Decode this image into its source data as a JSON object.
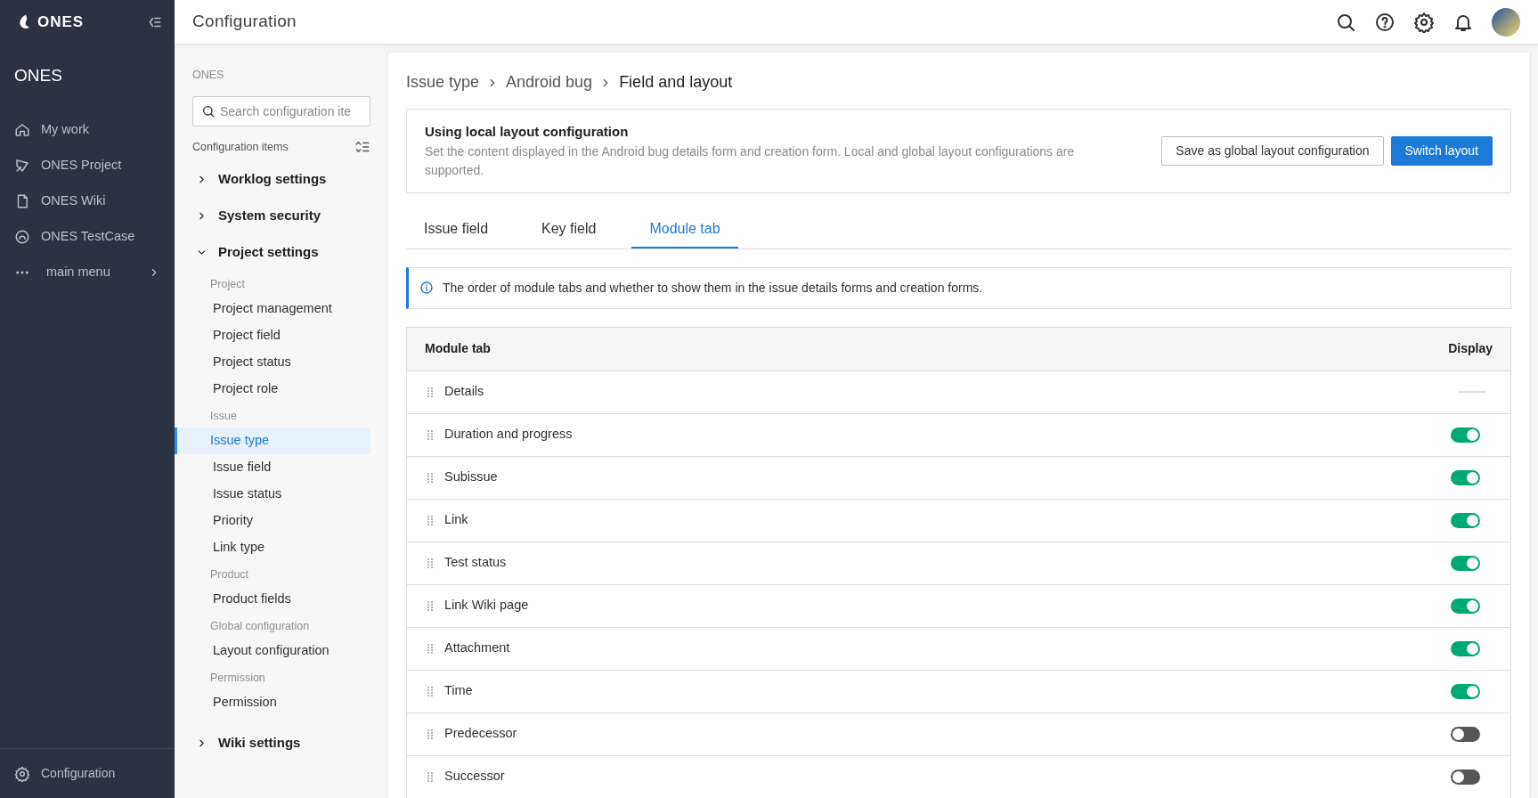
{
  "app_sidebar": {
    "logo_text": "ONES",
    "workspace": "ONES",
    "items": [
      {
        "label": "My work",
        "kind": "app"
      },
      {
        "label": "ONES Project",
        "kind": "app"
      },
      {
        "label": "ONES Wiki",
        "kind": "app"
      },
      {
        "label": "ONES TestCase",
        "kind": "app"
      },
      {
        "label": "main menu",
        "kind": "menu"
      }
    ],
    "footer": "Configuration"
  },
  "header": {
    "title": "Configuration"
  },
  "config_nav": {
    "org": "ONES",
    "search": {
      "placeholder": "Search configuration ite"
    },
    "heading": "Configuration items",
    "sections": [
      {
        "label": "Worklog settings",
        "expanded": false
      },
      {
        "label": "System security",
        "expanded": false
      },
      {
        "label": "Project settings",
        "expanded": true,
        "groups": [
          {
            "label": "Project",
            "items": [
              {
                "label": "Project management",
                "selected": false
              },
              {
                "label": "Project field",
                "selected": false
              },
              {
                "label": "Project status",
                "selected": false
              },
              {
                "label": "Project role",
                "selected": false
              }
            ]
          },
          {
            "label": "Issue",
            "items": [
              {
                "label": "Issue type",
                "selected": true
              },
              {
                "label": "Issue field",
                "selected": false
              },
              {
                "label": "Issue status",
                "selected": false
              },
              {
                "label": "Priority",
                "selected": false
              },
              {
                "label": "Link type",
                "selected": false
              }
            ]
          },
          {
            "label": "Product",
            "items": [
              {
                "label": "Product fields",
                "selected": false
              }
            ]
          },
          {
            "label": "Global configuration",
            "items": [
              {
                "label": "Layout configuration",
                "selected": false
              }
            ]
          },
          {
            "label": "Permission",
            "items": [
              {
                "label": "Permission",
                "selected": false
              }
            ]
          }
        ]
      },
      {
        "label": "Wiki settings",
        "expanded": false
      }
    ]
  },
  "breadcrumb": [
    "Issue type",
    "Android bug",
    "Field and layout"
  ],
  "layout_notice": {
    "title": "Using local layout configuration",
    "description": "Set the content displayed in the Android bug details form and creation form. Local and global layout configurations are supported.",
    "buttons": [
      {
        "label": "Save as global layout configuration",
        "kind": "secondary"
      },
      {
        "label": "Switch layout",
        "kind": "primary"
      }
    ]
  },
  "tabs": [
    {
      "label": "Issue field",
      "selected": false
    },
    {
      "label": "Key field",
      "selected": false
    },
    {
      "label": "Module tab",
      "selected": true
    }
  ],
  "info": "The order of module tabs and whether to show them in the issue details forms and creation forms.",
  "table": {
    "columns": [
      "Module tab",
      "Display"
    ],
    "rows": [
      {
        "name": "Details",
        "kind": "fixed"
      },
      {
        "name": "Duration and progress",
        "kind": "toggle",
        "on": true
      },
      {
        "name": "Subissue",
        "kind": "toggle",
        "on": true
      },
      {
        "name": "Link",
        "kind": "toggle",
        "on": true
      },
      {
        "name": "Test status",
        "kind": "toggle",
        "on": true
      },
      {
        "name": "Link Wiki page",
        "kind": "toggle",
        "on": true
      },
      {
        "name": "Attachment",
        "kind": "toggle",
        "on": true
      },
      {
        "name": "Time",
        "kind": "toggle",
        "on": true
      },
      {
        "name": "Predecessor",
        "kind": "toggle",
        "on": false
      },
      {
        "name": "Successor",
        "kind": "toggle",
        "on": false
      }
    ]
  }
}
